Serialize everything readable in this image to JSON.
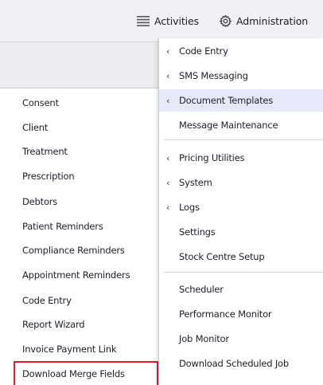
{
  "topbar": {
    "activities_label": "Activities",
    "activities_icon": "list-icon",
    "administration_label": "Administration",
    "administration_icon": "gear-icon"
  },
  "left_menu": {
    "items": [
      {
        "label": "Consent"
      },
      {
        "label": "Client"
      },
      {
        "label": "Treatment"
      },
      {
        "label": "Prescription"
      },
      {
        "label": "Debtors"
      },
      {
        "label": "Patient Reminders"
      },
      {
        "label": "Compliance Reminders"
      },
      {
        "label": "Appointment Reminders"
      },
      {
        "label": "Code Entry"
      },
      {
        "label": "Report Wizard"
      },
      {
        "label": "Invoice Payment Link"
      },
      {
        "label": "Download Merge Fields"
      }
    ],
    "highlight_color": "#d9212c"
  },
  "dropdown": {
    "items": [
      {
        "label": "Code Entry",
        "has_submenu": true
      },
      {
        "label": "SMS Messaging",
        "has_submenu": true
      },
      {
        "label": "Document Templates",
        "has_submenu": true,
        "active": true
      },
      {
        "label": "Message Maintenance",
        "has_submenu": false
      },
      {
        "label": "Pricing Utilities",
        "has_submenu": true
      },
      {
        "label": "System",
        "has_submenu": true
      },
      {
        "label": "Logs",
        "has_submenu": true
      },
      {
        "label": "Settings",
        "has_submenu": false
      },
      {
        "label": "Stock Centre Setup",
        "has_submenu": false
      },
      {
        "label": "Scheduler",
        "has_submenu": false
      },
      {
        "label": "Performance Monitor",
        "has_submenu": false
      },
      {
        "label": "Job Monitor",
        "has_submenu": false
      },
      {
        "label": "Download Scheduled Job",
        "has_submenu": false
      }
    ],
    "submenu_glyph": "‹",
    "active_bg": "#e8e8fb"
  }
}
